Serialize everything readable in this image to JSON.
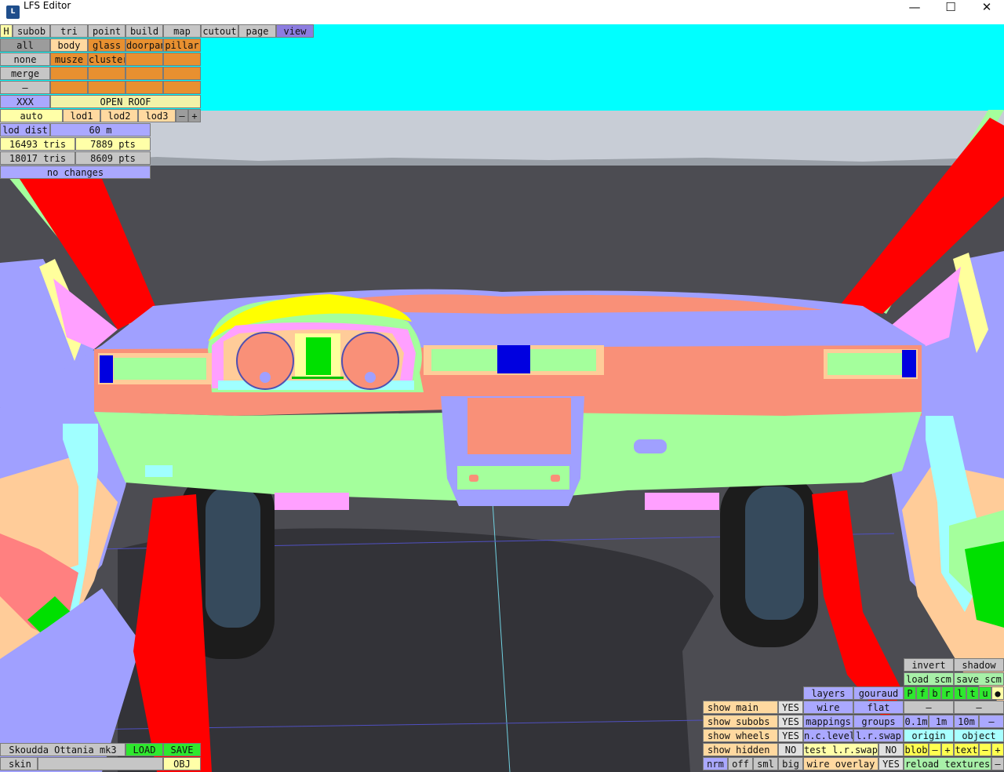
{
  "window": {
    "title": "LFS Editor",
    "icon": "lfs-logo-icon",
    "minimize": "—",
    "maximize": "☐",
    "close": "✕"
  },
  "menu": {
    "h": "H",
    "tabs": [
      "subob",
      "tri",
      "point",
      "build",
      "map",
      "cutout",
      "page",
      "view"
    ],
    "active": "view"
  },
  "selection": {
    "all": "all",
    "none": "none",
    "merge": "merge",
    "dash": "–",
    "xxx": "XXX",
    "row1": [
      "body",
      "glass",
      "doorpan",
      "pillar"
    ],
    "row2": [
      "musze",
      "cluster",
      "",
      ""
    ],
    "row3": [
      "",
      "",
      "",
      ""
    ],
    "row4": [
      "",
      "",
      "",
      ""
    ],
    "open_roof": "OPEN ROOF"
  },
  "lod": {
    "auto": "auto",
    "levels": [
      "lod1",
      "lod2",
      "lod3"
    ],
    "minus": "–",
    "plus": "+",
    "dist_label": "lod dist",
    "dist_value": "60 m"
  },
  "stats": {
    "tris1": "16493 tris",
    "pts1": "7889 pts",
    "tris2": "18017 tris",
    "pts2": "8609 pts",
    "changes": "no changes"
  },
  "bottom_left": {
    "car_name": "Skoudda Ottania mk3",
    "load": "LOAD",
    "save": "SAVE",
    "skin": "skin",
    "skin_value": "",
    "obj": "OBJ"
  },
  "right_panel": {
    "invert": "invert",
    "shadow": "shadow",
    "load_scm": "load scm",
    "save_scm": "save scm",
    "letters": [
      "P",
      "f",
      "b",
      "r",
      "l",
      "t",
      "u",
      "●"
    ],
    "layers": "layers",
    "gouraud": "gouraud",
    "wire": "wire",
    "flat": "flat",
    "mappings": "mappings",
    "groups": "groups",
    "nc_level": "n.c.level",
    "lr_swap": "l.r.swap",
    "test_lr_swap": "test l.r.swap",
    "test_lr_swap_value": "NO",
    "wire_overlay": "wire overlay",
    "wire_overlay_value": "YES",
    "dash1": "–",
    "dash2": "–",
    "dash3": "–",
    "grid": [
      "0.1m",
      "1m",
      "10m"
    ],
    "grid_minus": "–",
    "origin": "origin",
    "object": "object",
    "blob": "blob",
    "blob_minus": "–",
    "blob_plus": "+",
    "text": "text",
    "text_minus": "–",
    "text_plus": "+",
    "reload_textures": "reload textures",
    "dash4": "–"
  },
  "show_panel": {
    "main": "show main",
    "main_v": "YES",
    "subobs": "show subobs",
    "subobs_v": "YES",
    "wheels": "show wheels",
    "wheels_v": "YES",
    "hidden": "show hidden",
    "hidden_v": "NO",
    "nrm": "nrm",
    "off": "off",
    "sml": "sml",
    "big": "big"
  },
  "colors": {
    "sky": "#00ffff",
    "dash_salmon": "#f99078",
    "dash_green": "#a4ff9c",
    "pillar_red": "#ff0000",
    "trim_lilac": "#a0a0ff",
    "vent_blue": "#0000e0",
    "panel_bg": "#fff"
  }
}
